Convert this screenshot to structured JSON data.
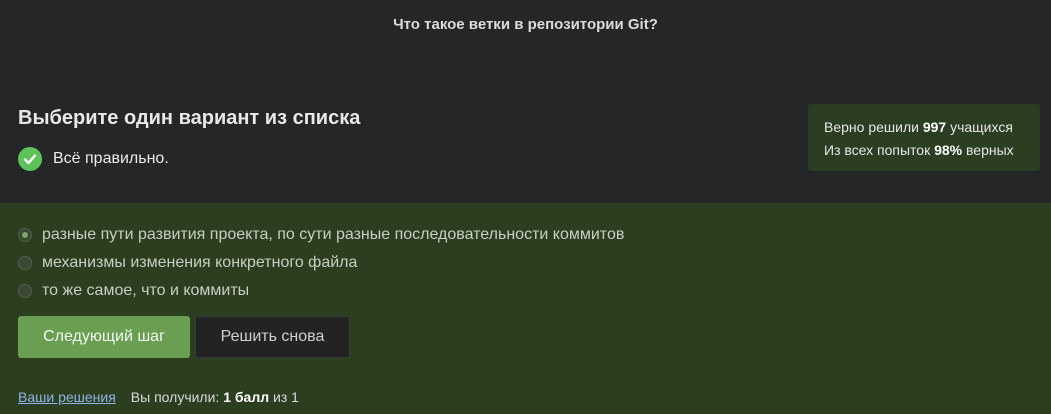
{
  "question": {
    "title": "Что такое ветки в репозитории Git?"
  },
  "task": {
    "heading": "Выберите один вариант из списка",
    "result_text": "Всё правильно."
  },
  "stats": {
    "line1_prefix": "Верно решили",
    "solved_count": "997",
    "line1_suffix": "учащихся",
    "line2_prefix": "Из всех попыток",
    "percent": "98%",
    "line2_suffix": "верных"
  },
  "options": [
    {
      "label": "разные пути развития проекта, по сути разные последовательности коммитов",
      "selected": true
    },
    {
      "label": "механизмы изменения конкретного файла",
      "selected": false
    },
    {
      "label": "то же самое, что и коммиты",
      "selected": false
    }
  ],
  "buttons": {
    "next_label": "Следующий шаг",
    "retry_label": "Решить снова"
  },
  "footer": {
    "solutions_link": "Ваши решения",
    "score_prefix": "Вы получили:",
    "score_value": "1 балл",
    "score_suffix": "из 1"
  },
  "colors": {
    "background": "#252627",
    "answer_area": "#2b3e1f",
    "accent_green": "#6a9e53",
    "check_green": "#5fc35c",
    "link": "#8fb4e6"
  },
  "icons": {
    "result_icon": "check-circle-icon"
  }
}
